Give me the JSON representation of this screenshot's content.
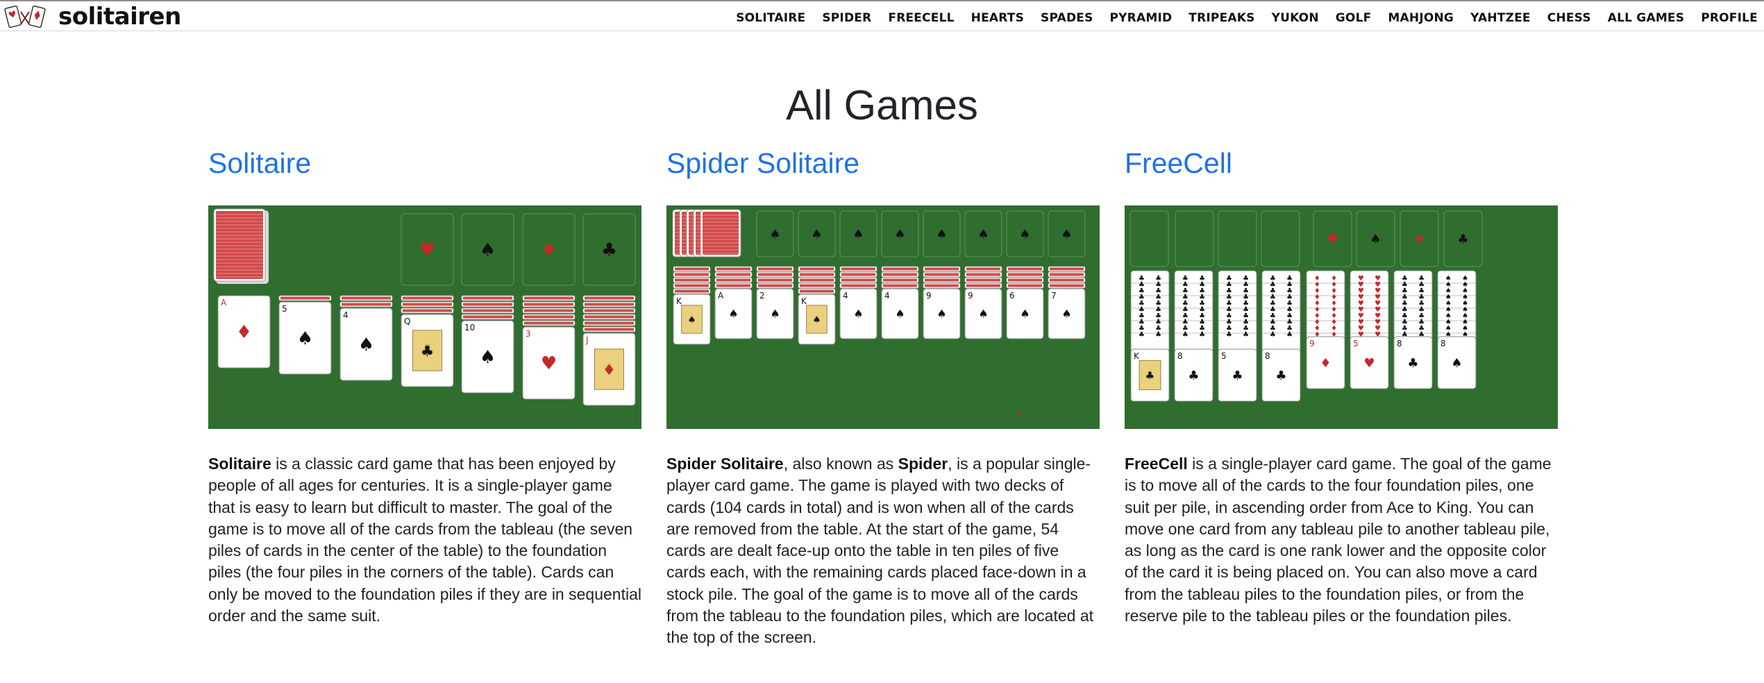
{
  "brand": {
    "name": "solitairen"
  },
  "nav": [
    "SOLITAIRE",
    "SPIDER",
    "FREECELL",
    "HEARTS",
    "SPADES",
    "PYRAMID",
    "TRIPEAKS",
    "YUKON",
    "GOLF",
    "MAHJONG",
    "YAHTZEE",
    "CHESS",
    "ALL GAMES",
    "PROFILE"
  ],
  "page": {
    "title": "All Games"
  },
  "games": [
    {
      "title": "Solitaire",
      "desc": {
        "segments": [
          {
            "text": "Solitaire",
            "bold": true
          },
          {
            "text": " is a classic card game that has been enjoyed by people of all ages for centuries. It is a single-player game that is easy to learn but difficult to master. The goal of the game is to move all of the cards from the tableau (the seven piles of cards in the center of the table) to the foundation piles (the four piles in the corners of the table). Cards can only be moved to the foundation piles if they are in sequential order and the same suit.",
            "bold": false
          }
        ]
      }
    },
    {
      "title": "Spider Solitaire",
      "desc": {
        "segments": [
          {
            "text": "Spider Solitaire",
            "bold": true
          },
          {
            "text": ", also known as ",
            "bold": false
          },
          {
            "text": "Spider",
            "bold": true
          },
          {
            "text": ", is a popular single-player card game. The game is played with two decks of cards (104 cards in total) and is won when all of the cards are removed from the table. At the start of the game, 54 cards are dealt face-up onto the table in ten piles of five cards each, with the remaining cards placed face-down in a stock pile. The goal of the game is to move all of the cards from the tableau to the foundation piles, which are located at the top of the screen.",
            "bold": false
          }
        ]
      }
    },
    {
      "title": "FreeCell",
      "desc": {
        "segments": [
          {
            "text": "FreeCell",
            "bold": true
          },
          {
            "text": " is a single-player card game. The goal of the game is to move all of the cards to the four foundation piles, one suit per pile, in ascending order from Ace to King. You can move one card from any tableau pile to another tableau pile, as long as the card is one rank lower and the opposite color of the card it is being placed on. You can also move a card from the tableau piles to the foundation piles, or from the reserve pile to the tableau piles or the foundation piles.",
            "bold": false
          }
        ]
      }
    }
  ],
  "preview_cards": {
    "solitaire": {
      "foundation_suits": [
        "heart-icon",
        "spade-icon",
        "diamond-icon",
        "club-icon"
      ],
      "tableau_top": [
        {
          "rank": "A",
          "suit": "diamond"
        },
        {
          "rank": "5",
          "suit": "spade"
        },
        {
          "rank": "4",
          "suit": "spade"
        },
        {
          "rank": "Q",
          "suit": "club"
        },
        {
          "rank": "10",
          "suit": "spade"
        },
        {
          "rank": "3",
          "suit": "heart"
        },
        {
          "rank": "J",
          "suit": "diamond"
        }
      ]
    },
    "spider": {
      "foundation_suits": [
        "spade-icon",
        "spade-icon",
        "spade-icon",
        "spade-icon",
        "spade-icon",
        "spade-icon",
        "spade-icon",
        "spade-icon"
      ],
      "tableau_top": [
        {
          "rank": "K",
          "suit": "spade"
        },
        {
          "rank": "A",
          "suit": "spade"
        },
        {
          "rank": "2",
          "suit": "spade"
        },
        {
          "rank": "K",
          "suit": "spade"
        },
        {
          "rank": "4",
          "suit": "spade"
        },
        {
          "rank": "4",
          "suit": "spade"
        },
        {
          "rank": "9",
          "suit": "spade"
        },
        {
          "rank": "9",
          "suit": "spade"
        },
        {
          "rank": "6",
          "suit": "spade"
        },
        {
          "rank": "7",
          "suit": "spade"
        }
      ]
    },
    "freecell": {
      "foundation_suits": [
        "heart-icon",
        "spade-icon",
        "diamond-icon",
        "club-icon"
      ],
      "tableau_top": [
        {
          "rank": "K",
          "suit": "club"
        },
        {
          "rank": "8",
          "suit": "club"
        },
        {
          "rank": "5",
          "suit": "club"
        },
        {
          "rank": "8",
          "suit": "club"
        },
        {
          "rank": "9",
          "suit": "diamond"
        },
        {
          "rank": "5",
          "suit": "heart"
        },
        {
          "rank": "8",
          "suit": "club"
        },
        {
          "rank": "8",
          "suit": "spade"
        }
      ]
    }
  },
  "colors": {
    "felt": "#2f6e2f",
    "link": "#1e72e6",
    "card_back": "#d24a4a",
    "red_suit": "#c62828",
    "black_suit": "#111111"
  }
}
